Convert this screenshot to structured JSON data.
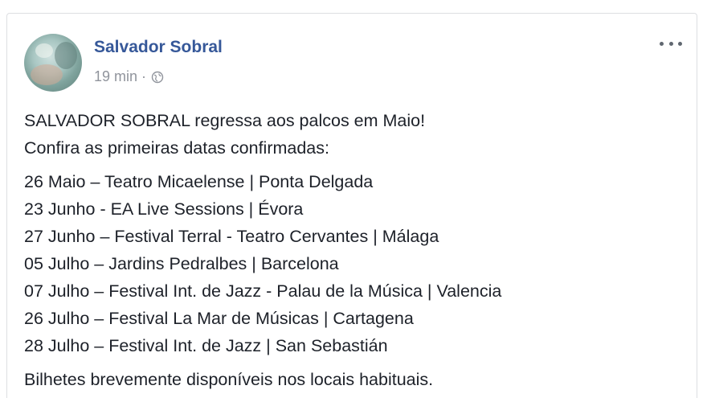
{
  "post": {
    "author": "Salvador Sobral",
    "time": "19 min",
    "separator": "·",
    "privacy_icon": "globe-icon",
    "more_icon": "more-options-icon",
    "intro_lines": [
      "SALVADOR SOBRAL regressa aos palcos em Maio!",
      "Confira as primeiras datas confirmadas:"
    ],
    "dates": [
      "26 Maio – Teatro Micaelense | Ponta Delgada",
      "23 Junho - EA Live Sessions | Évora",
      "27 Junho – Festival Terral - Teatro Cervantes | Málaga",
      "05 Julho – Jardins Pedralbes | Barcelona",
      "07 Julho – Festival Int. de Jazz - Palau de la Música | Valencia",
      "26 Julho – Festival La Mar de Músicas | Cartagena",
      "28 Julho – Festival Int. de Jazz | San Sebastián"
    ],
    "footer_line": "Bilhetes brevemente disponíveis nos locais habituais."
  },
  "colors": {
    "author": "#365899",
    "meta": "#90949c",
    "text": "#1d2129",
    "border": "#dddfe2"
  }
}
